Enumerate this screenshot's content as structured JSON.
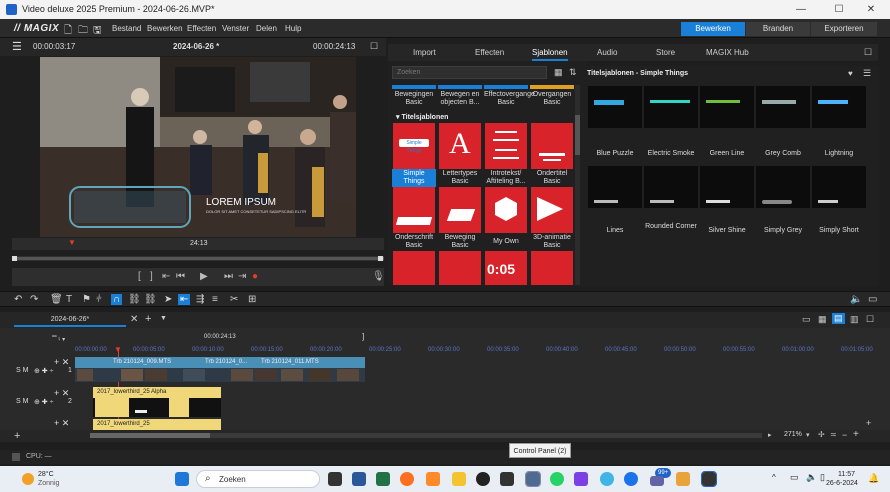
{
  "window": {
    "title": "Video deluxe 2025 Premium - 2024-06-26.MVP*",
    "controls": [
      "minimize-icon",
      "maximize-icon",
      "close-icon"
    ]
  },
  "menu": {
    "logo": "// MAGIX",
    "items": [
      "Bestand",
      "Bewerken",
      "Effecten",
      "Venster",
      "Delen",
      "Hulp"
    ],
    "modes": [
      {
        "label": "Bewerken",
        "active": true
      },
      {
        "label": "Branden",
        "active": false
      },
      {
        "label": "Exporteren",
        "active": false
      }
    ]
  },
  "preview": {
    "time_left": "00:00:03:17",
    "project": "2024-06-26 *",
    "time_right": "00:00:24:13",
    "scrub_time": "24:13",
    "overlay_title": "LOREM IPSUM",
    "overlay_sub": "DOLOR SIT AMET CONSETETUR SADIPSCING ELITR"
  },
  "pool": {
    "tabs": [
      {
        "label": "Import",
        "active": false
      },
      {
        "label": "Effecten",
        "active": false
      },
      {
        "label": "Sjablonen",
        "active": true
      },
      {
        "label": "Audio",
        "active": false
      },
      {
        "label": "Store",
        "active": false
      },
      {
        "label": "MAGIX Hub",
        "active": false
      }
    ],
    "search_placeholder": "Zoeken",
    "top_row": [
      "Bewegingen Basic",
      "Bewegen en objecten B...",
      "Effectovergange Basic",
      "Overgangen Basic"
    ],
    "section": "Titelsjablonen",
    "tiles": [
      {
        "label": "Simple Things",
        "selected": true
      },
      {
        "label": "Lettertypes Basic",
        "selected": false
      },
      {
        "label": "Introtekst/ Aftiteling B...",
        "selected": false
      },
      {
        "label": "Ondertitel Basic",
        "selected": false
      },
      {
        "label": "Onderschrift Basic",
        "selected": false
      },
      {
        "label": "Beweging Basic",
        "selected": false
      },
      {
        "label": "My Own",
        "selected": false
      },
      {
        "label": "3D-animatie Basic",
        "selected": false
      }
    ],
    "tile_thumb_text": "0:05",
    "right_title": "Titelsjablonen - Simple Things",
    "templates": [
      "Blue Puzzle",
      "Electric Smoke",
      "Green Line",
      "Grey Comb",
      "Lightning",
      "Lines",
      "Rounded Corner",
      "Silver Shine",
      "Simply Grey",
      "Simply Short"
    ]
  },
  "timeline": {
    "tab_label": "2024-06-26*",
    "marker_time": "00:00:24:13",
    "ruler": [
      "00:00:00:00",
      "00:00:05:00",
      "00:00:10:00",
      "00:00:15:00",
      "00:00:20:00",
      "00:00:25:00",
      "00:00:30:00",
      "00:00:35:00",
      "00:00:40:00",
      "00:00:45:00",
      "00:00:50:00",
      "00:00:55:00",
      "00:01:00:00",
      "00:01:05:00"
    ],
    "tracks": [
      {
        "num": "1",
        "flags": "S M"
      },
      {
        "num": "2",
        "flags": "S M"
      }
    ],
    "clips_video": [
      "Trb 210124_009.MTS",
      "Trb 210124_0...",
      "Trb 210124_011.MTS"
    ],
    "clip_title_a": "2017_lowerthird_25 Alpha",
    "clip_title_b": "2017_lowerthird_25",
    "zoom": "271%"
  },
  "status": {
    "cpu": "CPU: —",
    "tooltip": "Control Panel (2)"
  },
  "taskbar": {
    "weather_temp": "28°C",
    "weather_desc": "Zonnig",
    "search": "Zoeken",
    "badge": "99+",
    "time": "11:57",
    "date": "26-6-2024"
  }
}
